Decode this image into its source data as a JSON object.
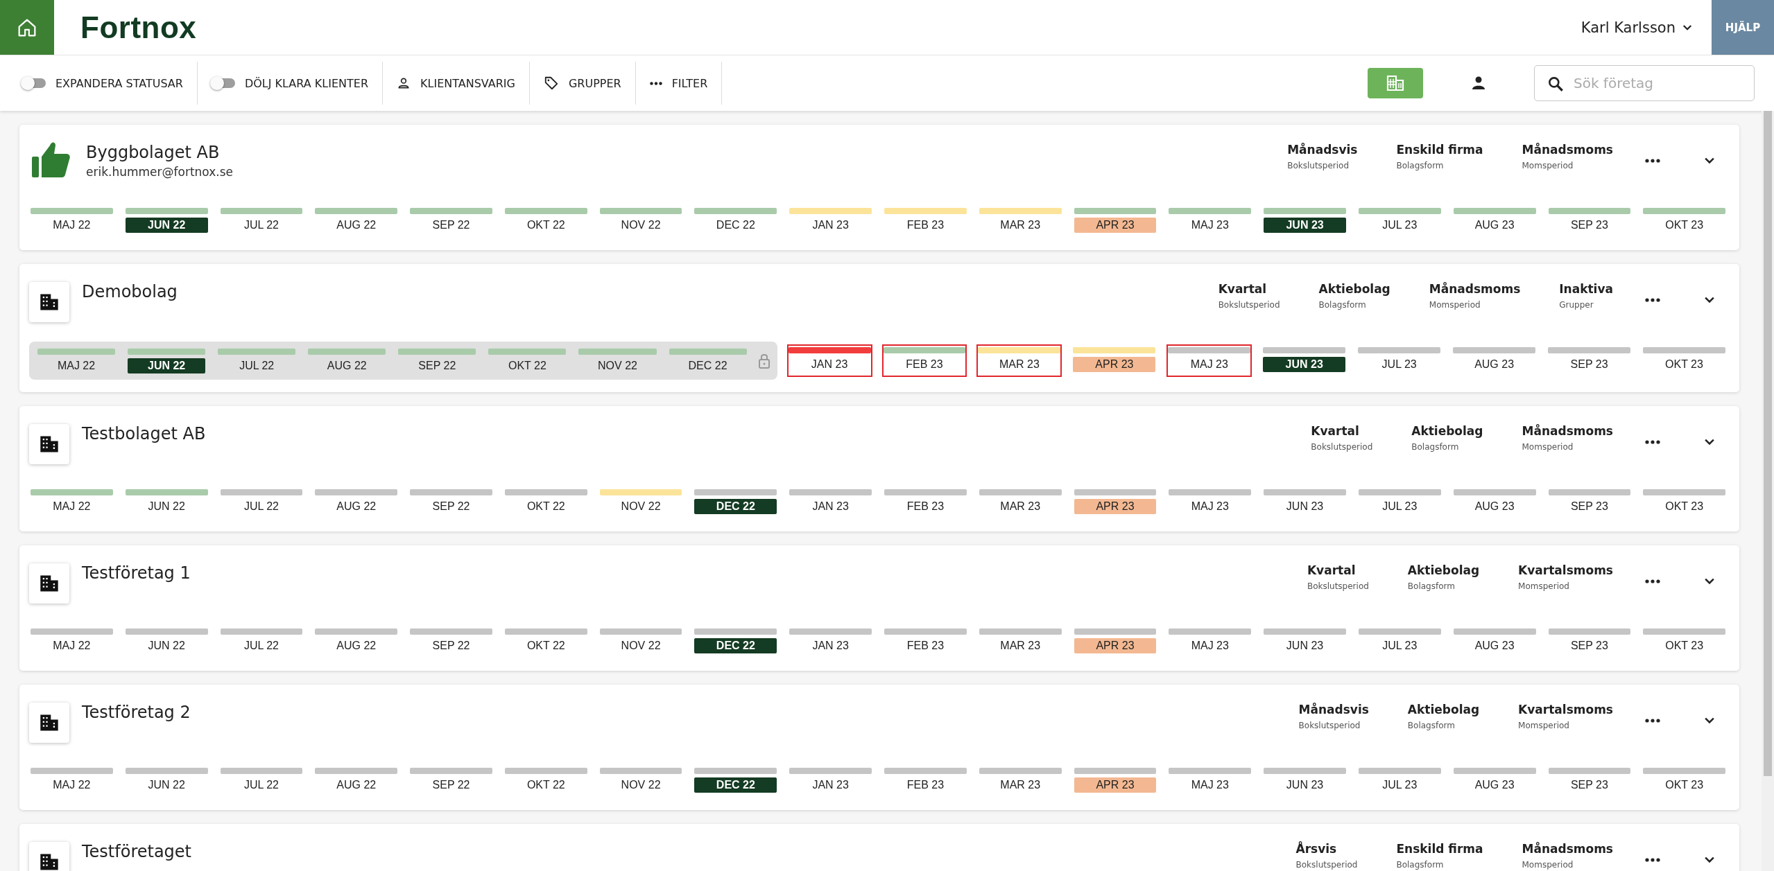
{
  "header": {
    "logo": "Fortnox",
    "user": "Karl Karlsson",
    "help": "HJÄLP"
  },
  "toolbar": {
    "items": [
      {
        "kind": "toggle",
        "label": "EXPANDERA STATUSAR",
        "on": false
      },
      {
        "kind": "toggle",
        "label": "DÖLJ KLARA KLIENTER",
        "on": false
      },
      {
        "kind": "person",
        "label": "KLIENTANSVARIG"
      },
      {
        "kind": "tag",
        "label": "GRUPPER"
      },
      {
        "kind": "dots",
        "label": "FILTER"
      }
    ],
    "views": [
      {
        "kind": "building",
        "selected": true
      },
      {
        "kind": "person",
        "selected": false
      }
    ],
    "search": {
      "placeholder": "Sök företag"
    }
  },
  "companies": [
    {
      "name": "Byggbolaget AB",
      "email": "erik.hummer@fortnox.se",
      "kind": "thumb",
      "attributes": [
        {
          "value": "Månadsvis",
          "label": "Bokslutsperiod"
        },
        {
          "value": "Enskild firma",
          "label": "Bolagsform"
        },
        {
          "value": "Månadsmoms",
          "label": "Momsperiod"
        }
      ],
      "months": [
        {
          "label": "MAJ 22",
          "color": "#a9cbaa",
          "current": false,
          "overdue": false,
          "flagged": false
        },
        {
          "label": "JUN 22",
          "color": "#a9cbaa",
          "current": true,
          "overdue": false,
          "flagged": false
        },
        {
          "label": "JUL 22",
          "color": "#a9cbaa",
          "current": false,
          "overdue": false,
          "flagged": false
        },
        {
          "label": "AUG 22",
          "color": "#a9cbaa",
          "current": false,
          "overdue": false,
          "flagged": false
        },
        {
          "label": "SEP 22",
          "color": "#a9cbaa",
          "current": false,
          "overdue": false,
          "flagged": false
        },
        {
          "label": "OKT 22",
          "color": "#a9cbaa",
          "current": false,
          "overdue": false,
          "flagged": false
        },
        {
          "label": "NOV 22",
          "color": "#a9cbaa",
          "current": false,
          "overdue": false,
          "flagged": false
        },
        {
          "label": "DEC 22",
          "color": "#a9cbaa",
          "current": false,
          "overdue": false,
          "flagged": false
        },
        {
          "label": "JAN 23",
          "color": "#fbe49a",
          "current": false,
          "overdue": false,
          "flagged": false
        },
        {
          "label": "FEB 23",
          "color": "#fbe49a",
          "current": false,
          "overdue": false,
          "flagged": false
        },
        {
          "label": "MAR 23",
          "color": "#fbe49a",
          "current": false,
          "overdue": false,
          "flagged": false
        },
        {
          "label": "APR 23",
          "color": "#a9cbaa",
          "current": false,
          "overdue": true,
          "flagged": false
        },
        {
          "label": "MAJ 23",
          "color": "#a9cbaa",
          "current": false,
          "overdue": false,
          "flagged": false
        },
        {
          "label": "JUN 23",
          "color": "#a9cbaa",
          "current": true,
          "overdue": false,
          "flagged": false
        },
        {
          "label": "JUL 23",
          "color": "#a9cbaa",
          "current": false,
          "overdue": false,
          "flagged": false
        },
        {
          "label": "AUG 23",
          "color": "#a9cbaa",
          "current": false,
          "overdue": false,
          "flagged": false
        },
        {
          "label": "SEP 23",
          "color": "#a9cbaa",
          "current": false,
          "overdue": false,
          "flagged": false
        },
        {
          "label": "OKT 23",
          "color": "#a9cbaa",
          "current": false,
          "overdue": false,
          "flagged": false
        }
      ]
    },
    {
      "name": "Demobolag",
      "kind": "building",
      "attributes": [
        {
          "value": "Kvartal",
          "label": "Bokslutsperiod"
        },
        {
          "value": "Aktiebolag",
          "label": "Bolagsform"
        },
        {
          "value": "Månadsmoms",
          "label": "Momsperiod"
        },
        {
          "value": "Inaktiva",
          "label": "Grupper"
        }
      ],
      "locked_months": [
        {
          "label": "MAJ 22",
          "color": "#a9cbaa",
          "current": false,
          "overdue": false,
          "flagged": false
        },
        {
          "label": "JUN 22",
          "color": "#a9cbaa",
          "current": true,
          "overdue": false,
          "flagged": false
        },
        {
          "label": "JUL 22",
          "color": "#a9cbaa",
          "current": false,
          "overdue": false,
          "flagged": false
        },
        {
          "label": "AUG 22",
          "color": "#a9cbaa",
          "current": false,
          "overdue": false,
          "flagged": false
        },
        {
          "label": "SEP 22",
          "color": "#a9cbaa",
          "current": false,
          "overdue": false,
          "flagged": false
        },
        {
          "label": "OKT 22",
          "color": "#a9cbaa",
          "current": false,
          "overdue": false,
          "flagged": false
        },
        {
          "label": "NOV 22",
          "color": "#a9cbaa",
          "current": false,
          "overdue": false,
          "flagged": false
        },
        {
          "label": "DEC 22",
          "color": "#a9cbaa",
          "current": false,
          "overdue": false,
          "flagged": false
        }
      ],
      "months": [
        {
          "label": "JAN 23",
          "color": "#f23d3d",
          "current": false,
          "overdue": false,
          "flagged": true
        },
        {
          "label": "FEB 23",
          "color": "#a9cbaa",
          "current": false,
          "overdue": false,
          "flagged": true
        },
        {
          "label": "MAR 23",
          "color": "#fbe49a",
          "current": false,
          "overdue": false,
          "flagged": true
        },
        {
          "label": "APR 23",
          "color": "#fbe49a",
          "current": false,
          "overdue": true,
          "flagged": false
        },
        {
          "label": "MAJ 23",
          "color": "#c4c5c4",
          "current": false,
          "overdue": false,
          "flagged": true
        },
        {
          "label": "JUN 23",
          "color": "#c4c5c4",
          "current": true,
          "overdue": false,
          "flagged": false
        },
        {
          "label": "JUL 23",
          "color": "#c4c5c4",
          "current": false,
          "overdue": false,
          "flagged": false
        },
        {
          "label": "AUG 23",
          "color": "#c4c5c4",
          "current": false,
          "overdue": false,
          "flagged": false
        },
        {
          "label": "SEP 23",
          "color": "#c4c5c4",
          "current": false,
          "overdue": false,
          "flagged": false
        },
        {
          "label": "OKT 23",
          "color": "#c4c5c4",
          "current": false,
          "overdue": false,
          "flagged": false
        }
      ]
    },
    {
      "name": "Testbolaget AB",
      "kind": "building",
      "attributes": [
        {
          "value": "Kvartal",
          "label": "Bokslutsperiod"
        },
        {
          "value": "Aktiebolag",
          "label": "Bolagsform"
        },
        {
          "value": "Månadsmoms",
          "label": "Momsperiod"
        }
      ],
      "months": [
        {
          "label": "MAJ 22",
          "color": "#a9cbaa",
          "current": false,
          "overdue": false,
          "flagged": false
        },
        {
          "label": "JUN 22",
          "color": "#a9cbaa",
          "current": false,
          "overdue": false,
          "flagged": false
        },
        {
          "label": "JUL 22",
          "color": "#c4c5c4",
          "current": false,
          "overdue": false,
          "flagged": false
        },
        {
          "label": "AUG 22",
          "color": "#c4c5c4",
          "current": false,
          "overdue": false,
          "flagged": false
        },
        {
          "label": "SEP 22",
          "color": "#c4c5c4",
          "current": false,
          "overdue": false,
          "flagged": false
        },
        {
          "label": "OKT 22",
          "color": "#c4c5c4",
          "current": false,
          "overdue": false,
          "flagged": false
        },
        {
          "label": "NOV 22",
          "color": "#fbe49a",
          "current": false,
          "overdue": false,
          "flagged": false
        },
        {
          "label": "DEC 22",
          "color": "#c4c5c4",
          "current": true,
          "overdue": false,
          "flagged": false
        },
        {
          "label": "JAN 23",
          "color": "#c4c5c4",
          "current": false,
          "overdue": false,
          "flagged": false
        },
        {
          "label": "FEB 23",
          "color": "#c4c5c4",
          "current": false,
          "overdue": false,
          "flagged": false
        },
        {
          "label": "MAR 23",
          "color": "#c4c5c4",
          "current": false,
          "overdue": false,
          "flagged": false
        },
        {
          "label": "APR 23",
          "color": "#c4c5c4",
          "current": false,
          "overdue": true,
          "flagged": false
        },
        {
          "label": "MAJ 23",
          "color": "#c4c5c4",
          "current": false,
          "overdue": false,
          "flagged": false
        },
        {
          "label": "JUN 23",
          "color": "#c4c5c4",
          "current": false,
          "overdue": false,
          "flagged": false
        },
        {
          "label": "JUL 23",
          "color": "#c4c5c4",
          "current": false,
          "overdue": false,
          "flagged": false
        },
        {
          "label": "AUG 23",
          "color": "#c4c5c4",
          "current": false,
          "overdue": false,
          "flagged": false
        },
        {
          "label": "SEP 23",
          "color": "#c4c5c4",
          "current": false,
          "overdue": false,
          "flagged": false
        },
        {
          "label": "OKT 23",
          "color": "#c4c5c4",
          "current": false,
          "overdue": false,
          "flagged": false
        }
      ]
    },
    {
      "name": "Testföretag 1",
      "kind": "building",
      "attributes": [
        {
          "value": "Kvartal",
          "label": "Bokslutsperiod"
        },
        {
          "value": "Aktiebolag",
          "label": "Bolagsform"
        },
        {
          "value": "Kvartalsmoms",
          "label": "Momsperiod"
        }
      ],
      "months": [
        {
          "label": "MAJ 22",
          "color": "#c4c5c4",
          "current": false,
          "overdue": false,
          "flagged": false
        },
        {
          "label": "JUN 22",
          "color": "#c4c5c4",
          "current": false,
          "overdue": false,
          "flagged": false
        },
        {
          "label": "JUL 22",
          "color": "#c4c5c4",
          "current": false,
          "overdue": false,
          "flagged": false
        },
        {
          "label": "AUG 22",
          "color": "#c4c5c4",
          "current": false,
          "overdue": false,
          "flagged": false
        },
        {
          "label": "SEP 22",
          "color": "#c4c5c4",
          "current": false,
          "overdue": false,
          "flagged": false
        },
        {
          "label": "OKT 22",
          "color": "#c4c5c4",
          "current": false,
          "overdue": false,
          "flagged": false
        },
        {
          "label": "NOV 22",
          "color": "#c4c5c4",
          "current": false,
          "overdue": false,
          "flagged": false
        },
        {
          "label": "DEC 22",
          "color": "#c4c5c4",
          "current": true,
          "overdue": false,
          "flagged": false
        },
        {
          "label": "JAN 23",
          "color": "#c4c5c4",
          "current": false,
          "overdue": false,
          "flagged": false
        },
        {
          "label": "FEB 23",
          "color": "#c4c5c4",
          "current": false,
          "overdue": false,
          "flagged": false
        },
        {
          "label": "MAR 23",
          "color": "#c4c5c4",
          "current": false,
          "overdue": false,
          "flagged": false
        },
        {
          "label": "APR 23",
          "color": "#c4c5c4",
          "current": false,
          "overdue": true,
          "flagged": false
        },
        {
          "label": "MAJ 23",
          "color": "#c4c5c4",
          "current": false,
          "overdue": false,
          "flagged": false
        },
        {
          "label": "JUN 23",
          "color": "#c4c5c4",
          "current": false,
          "overdue": false,
          "flagged": false
        },
        {
          "label": "JUL 23",
          "color": "#c4c5c4",
          "current": false,
          "overdue": false,
          "flagged": false
        },
        {
          "label": "AUG 23",
          "color": "#c4c5c4",
          "current": false,
          "overdue": false,
          "flagged": false
        },
        {
          "label": "SEP 23",
          "color": "#c4c5c4",
          "current": false,
          "overdue": false,
          "flagged": false
        },
        {
          "label": "OKT 23",
          "color": "#c4c5c4",
          "current": false,
          "overdue": false,
          "flagged": false
        }
      ]
    },
    {
      "name": "Testföretag 2",
      "kind": "building",
      "attributes": [
        {
          "value": "Månadsvis",
          "label": "Bokslutsperiod"
        },
        {
          "value": "Aktiebolag",
          "label": "Bolagsform"
        },
        {
          "value": "Kvartalsmoms",
          "label": "Momsperiod"
        }
      ],
      "months": [
        {
          "label": "MAJ 22",
          "color": "#c4c5c4",
          "current": false,
          "overdue": false,
          "flagged": false
        },
        {
          "label": "JUN 22",
          "color": "#c4c5c4",
          "current": false,
          "overdue": false,
          "flagged": false
        },
        {
          "label": "JUL 22",
          "color": "#c4c5c4",
          "current": false,
          "overdue": false,
          "flagged": false
        },
        {
          "label": "AUG 22",
          "color": "#c4c5c4",
          "current": false,
          "overdue": false,
          "flagged": false
        },
        {
          "label": "SEP 22",
          "color": "#c4c5c4",
          "current": false,
          "overdue": false,
          "flagged": false
        },
        {
          "label": "OKT 22",
          "color": "#c4c5c4",
          "current": false,
          "overdue": false,
          "flagged": false
        },
        {
          "label": "NOV 22",
          "color": "#c4c5c4",
          "current": false,
          "overdue": false,
          "flagged": false
        },
        {
          "label": "DEC 22",
          "color": "#c4c5c4",
          "current": true,
          "overdue": false,
          "flagged": false
        },
        {
          "label": "JAN 23",
          "color": "#c4c5c4",
          "current": false,
          "overdue": false,
          "flagged": false
        },
        {
          "label": "FEB 23",
          "color": "#c4c5c4",
          "current": false,
          "overdue": false,
          "flagged": false
        },
        {
          "label": "MAR 23",
          "color": "#c4c5c4",
          "current": false,
          "overdue": false,
          "flagged": false
        },
        {
          "label": "APR 23",
          "color": "#c4c5c4",
          "current": false,
          "overdue": true,
          "flagged": false
        },
        {
          "label": "MAJ 23",
          "color": "#c4c5c4",
          "current": false,
          "overdue": false,
          "flagged": false
        },
        {
          "label": "JUN 23",
          "color": "#c4c5c4",
          "current": false,
          "overdue": false,
          "flagged": false
        },
        {
          "label": "JUL 23",
          "color": "#c4c5c4",
          "current": false,
          "overdue": false,
          "flagged": false
        },
        {
          "label": "AUG 23",
          "color": "#c4c5c4",
          "current": false,
          "overdue": false,
          "flagged": false
        },
        {
          "label": "SEP 23",
          "color": "#c4c5c4",
          "current": false,
          "overdue": false,
          "flagged": false
        },
        {
          "label": "OKT 23",
          "color": "#c4c5c4",
          "current": false,
          "overdue": false,
          "flagged": false
        }
      ]
    },
    {
      "name": "Testföretaget",
      "kind": "building",
      "attributes": [
        {
          "value": "Årsvis",
          "label": "Bokslutsperiod"
        },
        {
          "value": "Enskild firma",
          "label": "Bolagsform"
        },
        {
          "value": "Månadsmoms",
          "label": "Momsperiod"
        }
      ]
    }
  ]
}
